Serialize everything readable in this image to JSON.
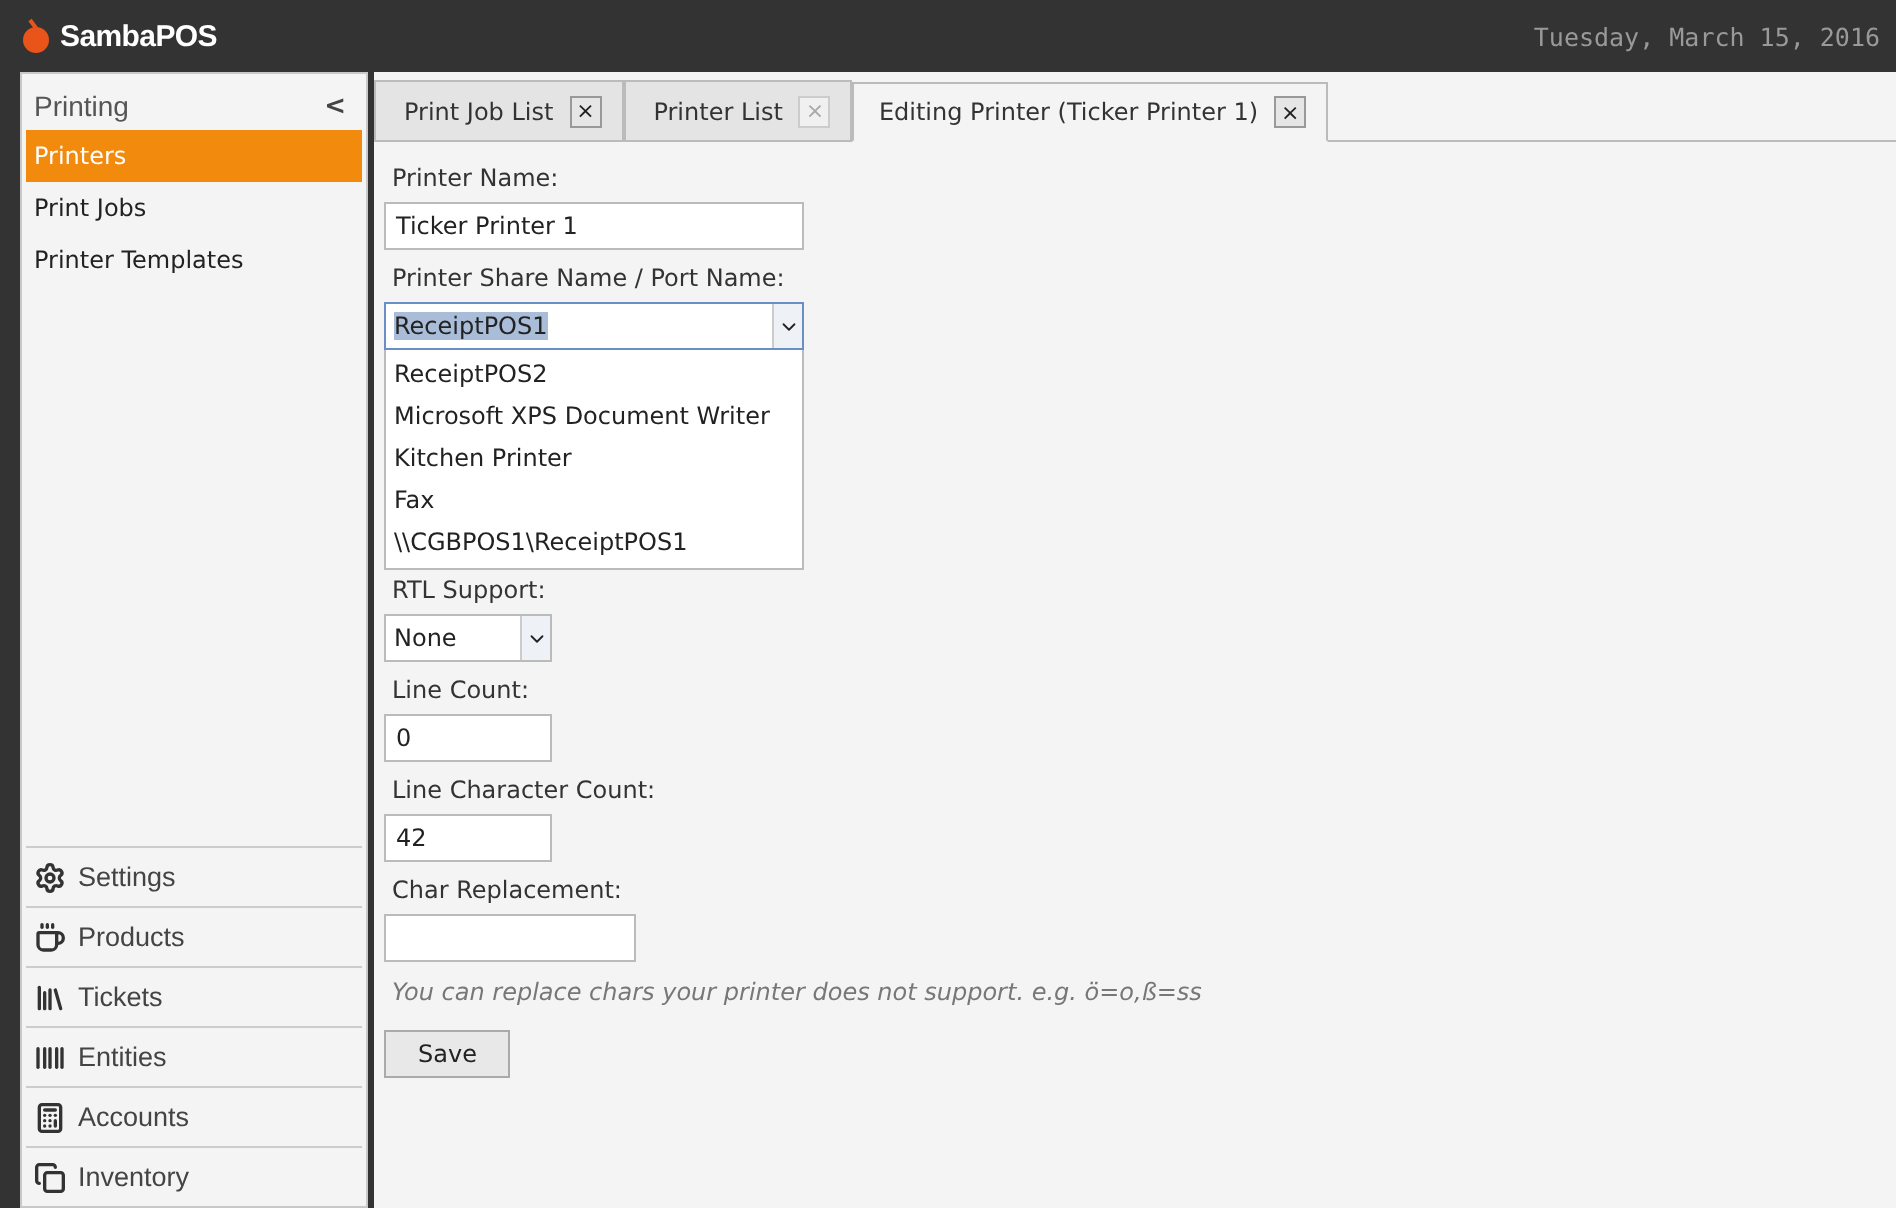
{
  "header": {
    "app_name": "SambaPOS",
    "date": "Tuesday, March 15, 2016"
  },
  "sidebar": {
    "title": "Printing",
    "collapse": "<",
    "items": [
      {
        "label": "Printers",
        "selected": true
      },
      {
        "label": "Print Jobs",
        "selected": false
      },
      {
        "label": "Printer Templates",
        "selected": false
      }
    ],
    "sections": [
      "Settings",
      "Products",
      "Tickets",
      "Entities",
      "Accounts",
      "Inventory"
    ]
  },
  "tabs": [
    {
      "label": "Print Job List",
      "selected": false,
      "close": "×",
      "close_enabled": true
    },
    {
      "label": "Printer List",
      "selected": false,
      "close": "×",
      "close_enabled": false
    },
    {
      "label": "Editing Printer (Ticker Printer 1)",
      "selected": true,
      "close": "×",
      "close_enabled": true
    }
  ],
  "form": {
    "fields": [
      {
        "kind": "text",
        "label": "Printer Name:",
        "value": "Ticker Printer 1"
      },
      {
        "kind": "dropdown",
        "label": "Printer Share Name / Port Name:",
        "value": "ReceiptPOS1",
        "expanded": true,
        "options": [
          "ReceiptPOS2",
          "Microsoft XPS Document Writer",
          "Kitchen Printer",
          "Fax",
          "\\\\CGBPOS1\\ReceiptPOS1"
        ]
      },
      {
        "kind": "select",
        "label": "RTL Support:",
        "value": "None"
      },
      {
        "kind": "number",
        "label": "Line Count:",
        "value": "0"
      },
      {
        "kind": "number",
        "label": "Line Character Count:",
        "value": "42"
      },
      {
        "kind": "char",
        "label": "Char Replacement:"
      }
    ],
    "hint": "You can replace chars your printer does not support. e.g. ö=o,ß=ss",
    "save": "Save"
  }
}
